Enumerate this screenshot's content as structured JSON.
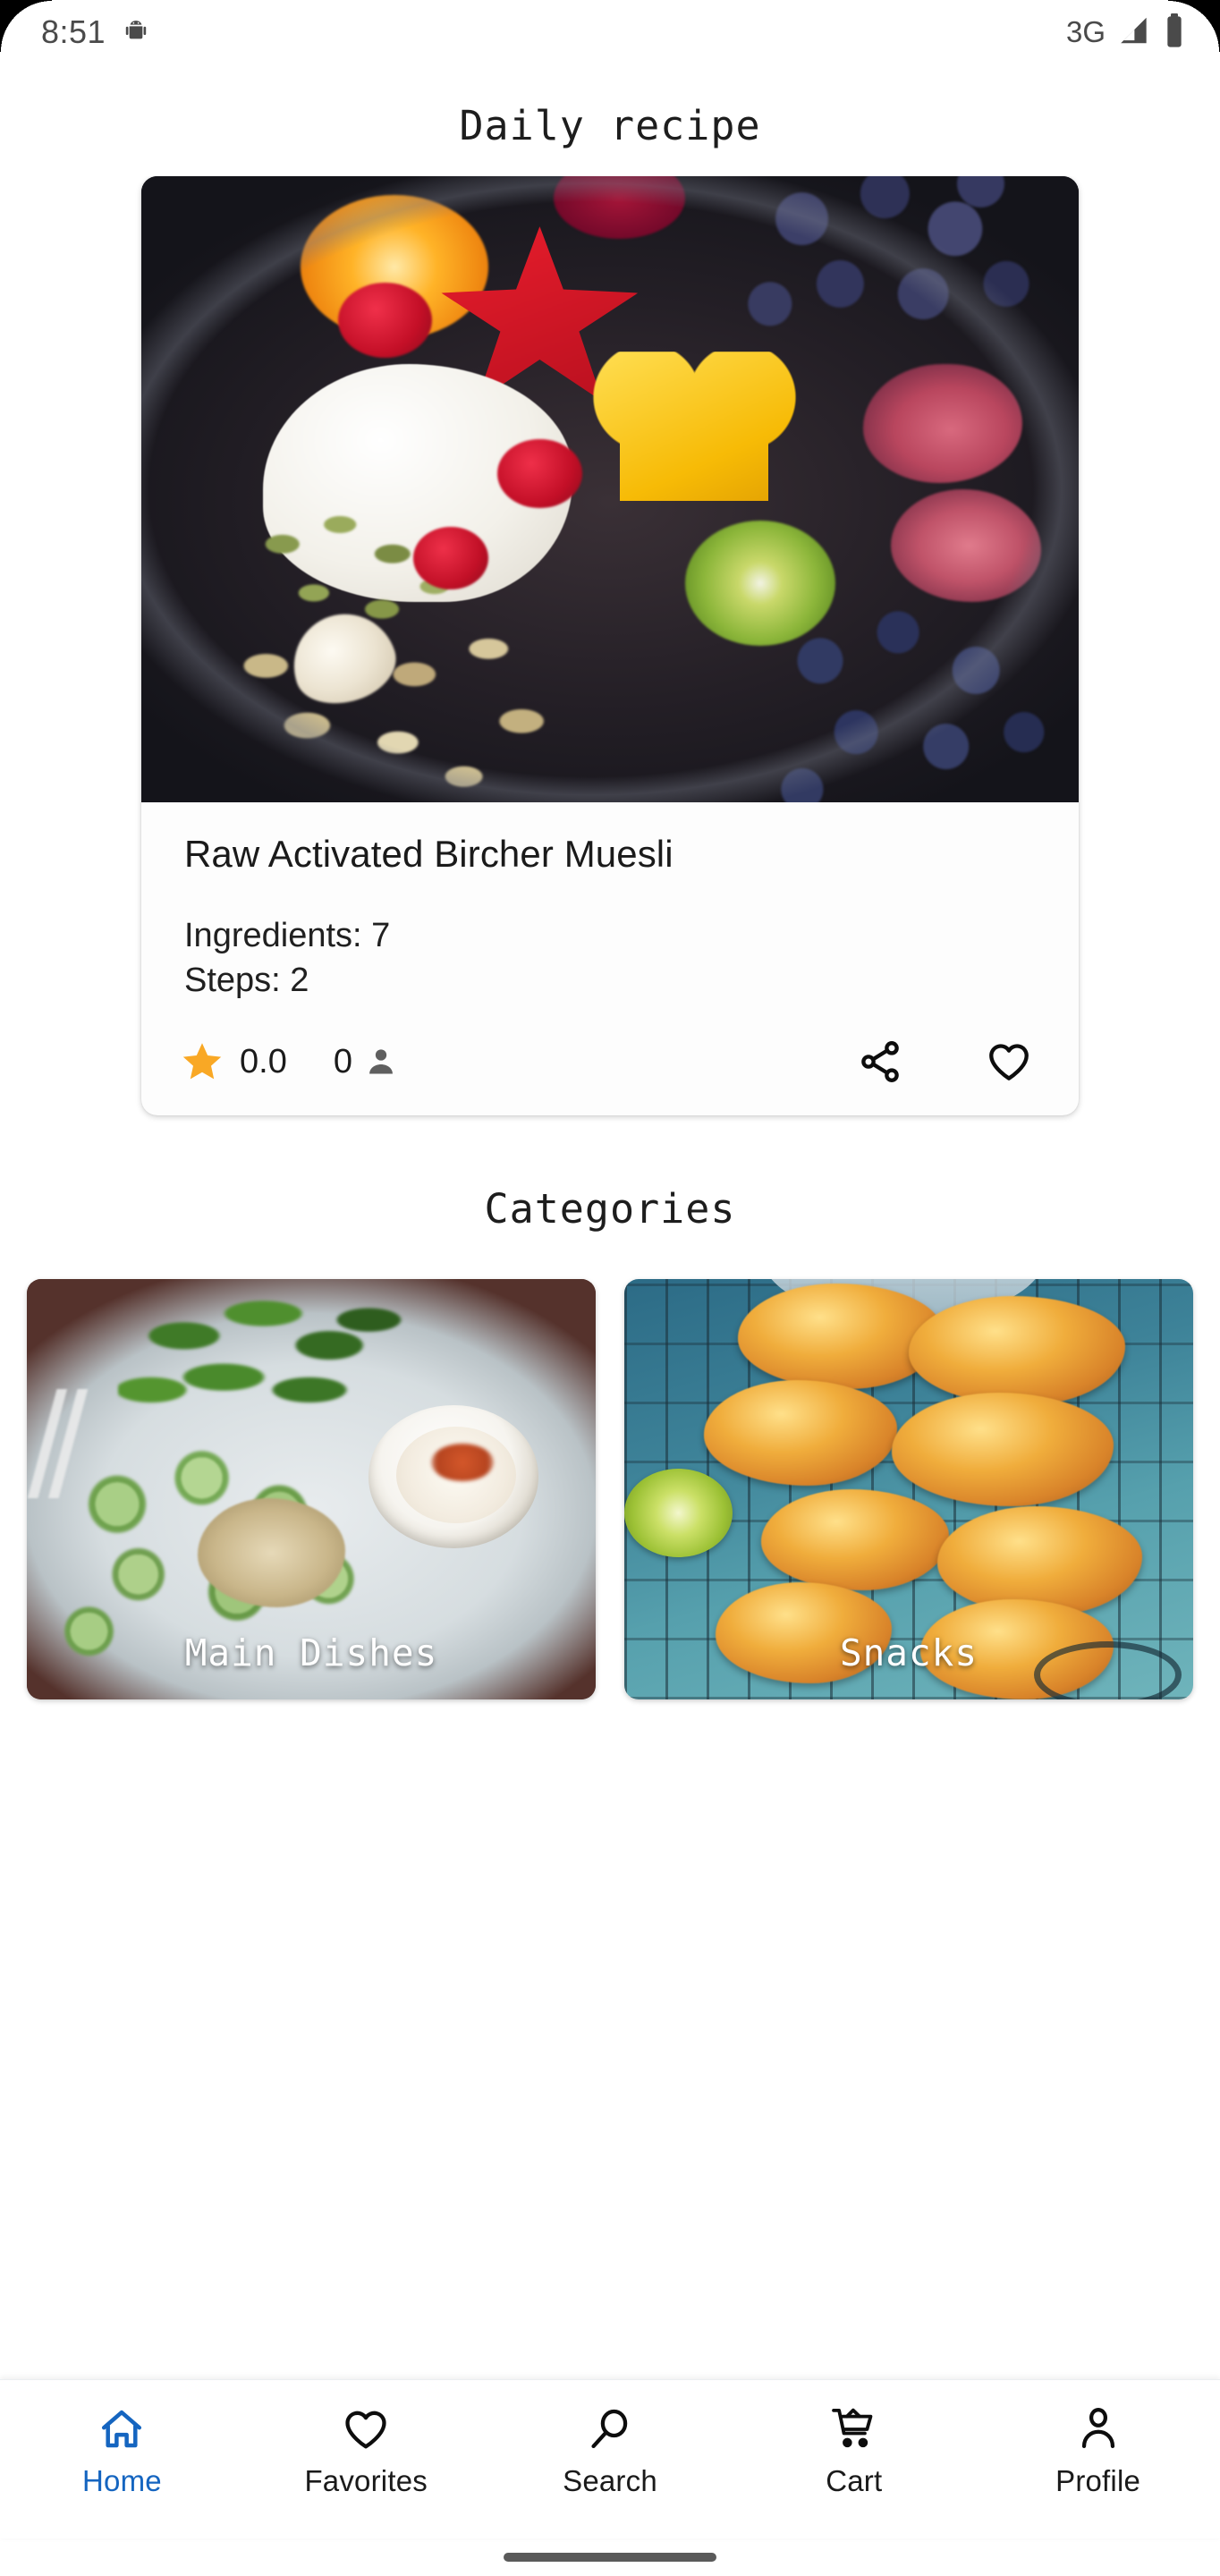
{
  "status_bar": {
    "time": "8:51",
    "left_icon": "android-robot-icon",
    "network": "3G",
    "signal_icon": "signal-bars-icon",
    "battery_icon": "battery-full-icon"
  },
  "header": {
    "title": "Daily recipe"
  },
  "daily_recipe": {
    "image_alt": "fruit-bowl-photo",
    "name": "Raw Activated Bircher Muesli",
    "ingredients_line": "Ingredients: 7",
    "steps_line": "Steps: 2",
    "rating_value": "0.0",
    "rating_count": "0",
    "star_icon": "star-filled-icon",
    "person_icon": "person-icon",
    "share_icon": "share-icon",
    "favorite_icon": "heart-outline-icon",
    "star_color": "#F9A825"
  },
  "categories_section": {
    "title": "Categories",
    "cards": [
      {
        "label": "Main Dishes",
        "image_alt": "salad-plate-photo"
      },
      {
        "label": "Snacks",
        "image_alt": "fritters-rack-photo"
      }
    ]
  },
  "bottom_nav": {
    "active_color": "#1565C0",
    "inactive_color": "#1A1A1A",
    "items": [
      {
        "label": "Home",
        "icon": "home-icon",
        "active": true
      },
      {
        "label": "Favorites",
        "icon": "heart-outline-icon",
        "active": false
      },
      {
        "label": "Search",
        "icon": "search-icon",
        "active": false
      },
      {
        "label": "Cart",
        "icon": "shopping-cart-icon",
        "active": false
      },
      {
        "label": "Profile",
        "icon": "person-outline-icon",
        "active": false
      }
    ]
  },
  "system": {
    "home_indicator": "home-indicator-bar"
  }
}
